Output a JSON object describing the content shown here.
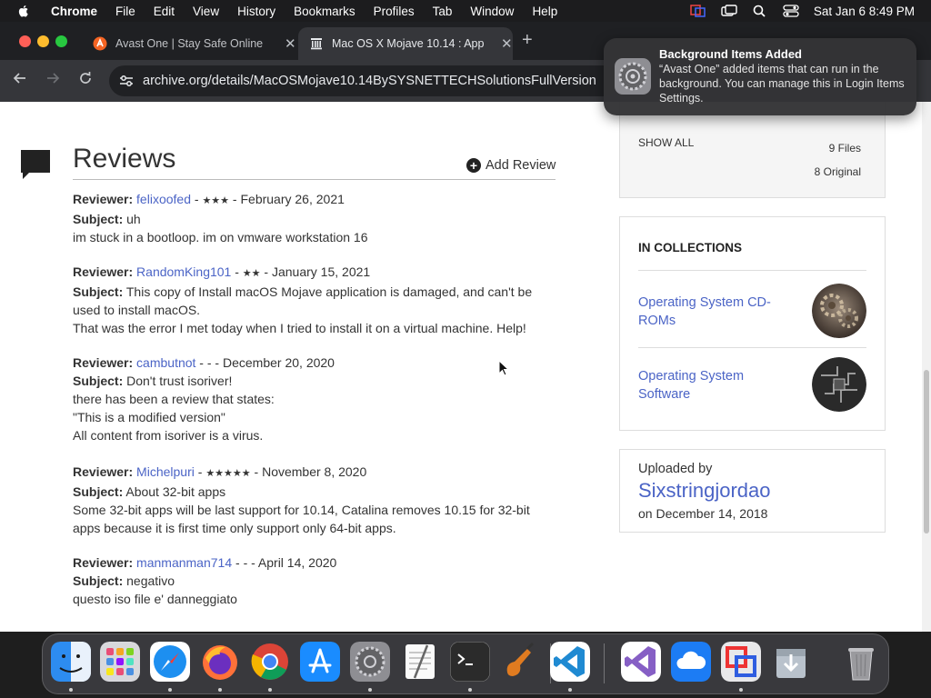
{
  "menubar": {
    "app_name": "Chrome",
    "items": [
      "File",
      "Edit",
      "View",
      "History",
      "Bookmarks",
      "Profiles",
      "Tab",
      "Window",
      "Help"
    ],
    "datetime": "Sat Jan 6  8:49 PM"
  },
  "browser": {
    "tabs": [
      {
        "title": "Avast One | Stay Safe Online",
        "active": false
      },
      {
        "title": "Mac OS X Mojave 10.14 : App",
        "active": true
      }
    ],
    "new_tab": "+",
    "address": "archive.org/details/MacOSMojave10.14BySYSNETTECHSolutionsFullVersion"
  },
  "notification": {
    "title": "Background Items Added",
    "body": "“Avast One” added items that can run in the background. You can manage this in Login Items Settings."
  },
  "reviews": {
    "title": "Reviews",
    "add_review": "Add Review",
    "reviewer_label": "Reviewer:",
    "subject_label": "Subject:",
    "items": [
      {
        "reviewer": "felixoofed",
        "rating": "★★★",
        "date": "February 26, 2021",
        "subject": "uh",
        "body": "im stuck in a bootloop. im on vmware workstation 16"
      },
      {
        "reviewer": "RandomKing101",
        "rating": "★★",
        "date": "January 15, 2021",
        "subject": "This copy of Install macOS Mojave application is damaged, and can't be used to install macOS.",
        "body": "That was the error I met today when I tried to install it on a virtual machine. Help!"
      },
      {
        "reviewer": "cambutnot",
        "rating": "-",
        "date": "December 20, 2020",
        "subject": "Don't trust isoriver!",
        "body_lines": [
          "there has been a review that states:",
          "\"This is a modified version\"",
          "All content from isoriver is a virus."
        ]
      },
      {
        "reviewer": "Michelpuri",
        "rating": "★★★★★",
        "date": "November 8, 2020",
        "subject": "About 32-bit apps",
        "body": "Some 32-bit apps will be last support for 10.14, Catalina removes 10.15 for 32-bit apps because it is first time only support only 64-bit apps."
      },
      {
        "reviewer": "manmanman714",
        "rating": "-",
        "date": "April 14, 2020",
        "subject": "negativo",
        "body": "questo iso file e' danneggiato"
      }
    ]
  },
  "files": {
    "show_all": "SHOW ALL",
    "count": "9 Files",
    "original": "8 Original"
  },
  "collections": {
    "title": "IN COLLECTIONS",
    "items": [
      {
        "label": "Operating System CD-ROMs"
      },
      {
        "label": "Operating System Software"
      }
    ]
  },
  "uploader": {
    "label": "Uploaded by",
    "name": "Sixstringjordao",
    "date": "on December 14, 2018"
  },
  "colors": {
    "link": "#4b64c6",
    "menubar": "#1c1c1e",
    "tabstrip": "#1f2023",
    "toolbar": "#35363a"
  },
  "dock": {
    "apps": [
      "finder-icon",
      "launchpad-icon",
      "safari-icon",
      "firefox-icon",
      "chrome-icon",
      "app-store-icon",
      "system-settings-icon",
      "textedit-icon",
      "terminal-icon",
      "garageband-icon",
      "vscode-icon",
      "visual-studio-icon",
      "icloud-icon",
      "parallels-icon",
      "downloads-icon",
      "trash-icon"
    ]
  }
}
